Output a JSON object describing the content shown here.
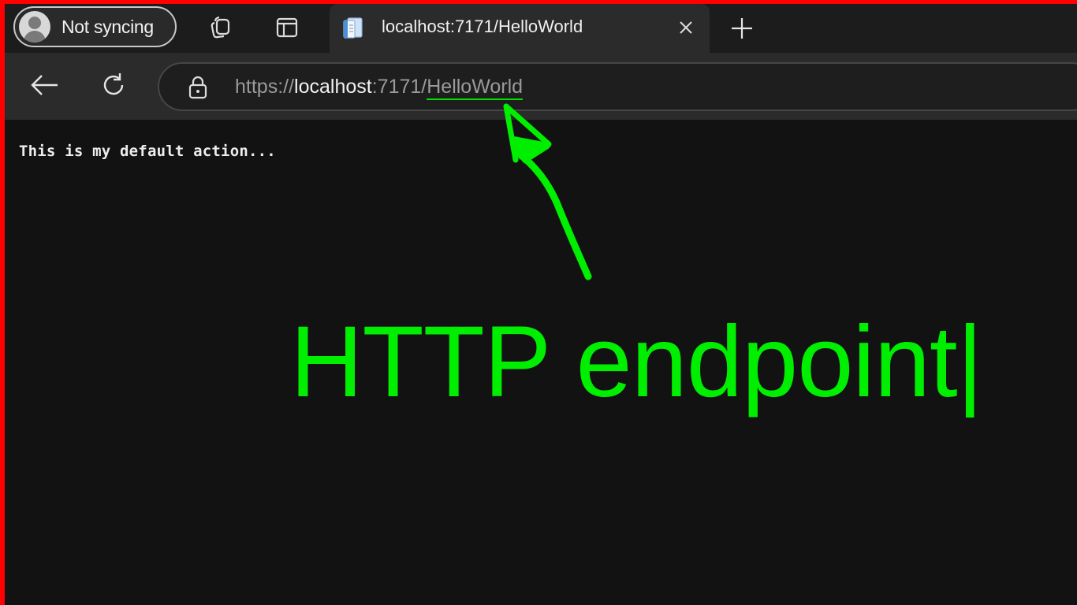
{
  "profile": {
    "label": "Not syncing"
  },
  "tab": {
    "title": "localhost:7171/HelloWorld"
  },
  "address_bar": {
    "scheme": "https://",
    "host": "localhost",
    "port": ":7171/",
    "path": "HelloWorld"
  },
  "page": {
    "body_text": "This is my default action..."
  },
  "annotation": {
    "text": "HTTP endpoint|",
    "color": "#00ee00"
  },
  "icons": {
    "workspaces": "workspaces-icon",
    "vertical_tabs": "vertical-tabs-icon",
    "favicon": "document-icon",
    "close": "close-icon",
    "new_tab": "plus-icon",
    "back": "back-arrow-icon",
    "refresh": "refresh-icon",
    "lock": "lock-icon"
  },
  "colors": {
    "border": "#ff0000",
    "accent": "#00ee00",
    "background": "#121212"
  }
}
